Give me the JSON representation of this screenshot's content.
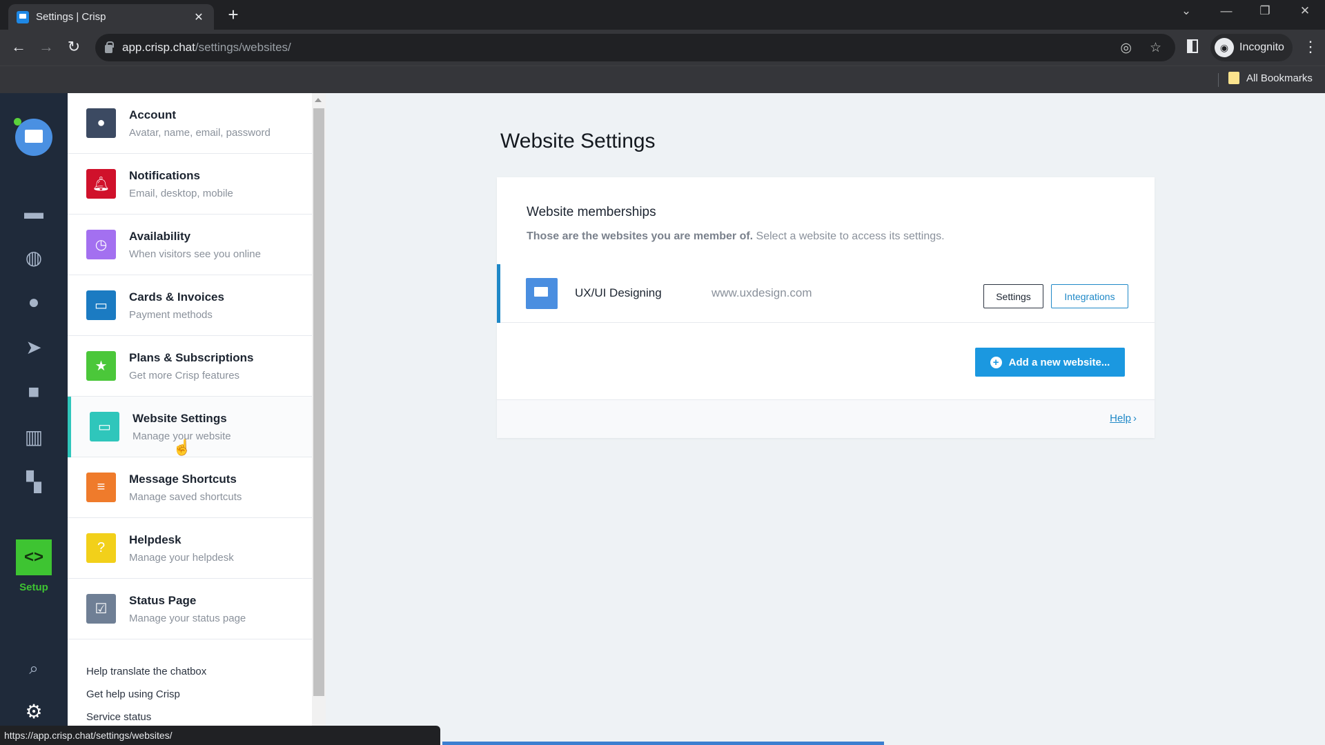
{
  "browser": {
    "tab_title": "Settings | Crisp",
    "url_host": "app.crisp.chat",
    "url_path": "/settings/websites/",
    "profile_label": "Incognito",
    "bookmarks_label": "All Bookmarks",
    "status_url": "https://app.crisp.chat/settings/websites/"
  },
  "rail": {
    "items": [
      "inbox",
      "visitors",
      "contacts",
      "campaigns",
      "helpdesk",
      "analytics",
      "plugins"
    ],
    "setup_label": "Setup"
  },
  "settings_nav": {
    "items": [
      {
        "title": "Account",
        "subtitle": "Avatar, name, email, password",
        "icon": "user-icon",
        "color": "#3c4a62"
      },
      {
        "title": "Notifications",
        "subtitle": "Email, desktop, mobile",
        "icon": "bell-icon",
        "color": "#d0112b"
      },
      {
        "title": "Availability",
        "subtitle": "When visitors see you online",
        "icon": "clock-icon",
        "color": "#a370f0"
      },
      {
        "title": "Cards & Invoices",
        "subtitle": "Payment methods",
        "icon": "card-icon",
        "color": "#1b7bc2"
      },
      {
        "title": "Plans & Subscriptions",
        "subtitle": "Get more Crisp features",
        "icon": "star-icon",
        "color": "#4bc73a"
      },
      {
        "title": "Website Settings",
        "subtitle": "Manage your website",
        "icon": "laptop-icon",
        "color": "#2fc6bb",
        "active": true
      },
      {
        "title": "Message Shortcuts",
        "subtitle": "Manage saved shortcuts",
        "icon": "message-icon",
        "color": "#ef7b2b"
      },
      {
        "title": "Helpdesk",
        "subtitle": "Manage your helpdesk",
        "icon": "helpdesk-icon",
        "color": "#f2d01a"
      },
      {
        "title": "Status Page",
        "subtitle": "Manage your status page",
        "icon": "check-icon",
        "color": "#6f7f95"
      }
    ],
    "links": [
      "Help translate the chatbox",
      "Get help using Crisp",
      "Service status"
    ]
  },
  "main": {
    "title": "Website Settings",
    "card": {
      "heading": "Website memberships",
      "desc_bold": "Those are the websites you are member of.",
      "desc_rest": " Select a website to access its settings.",
      "website": {
        "name": "UX/UI Designing",
        "url": "www.uxdesign.com"
      },
      "settings_button": "Settings",
      "integrations_button": "Integrations",
      "add_button": "Add a new website...",
      "help_link": "Help"
    }
  }
}
